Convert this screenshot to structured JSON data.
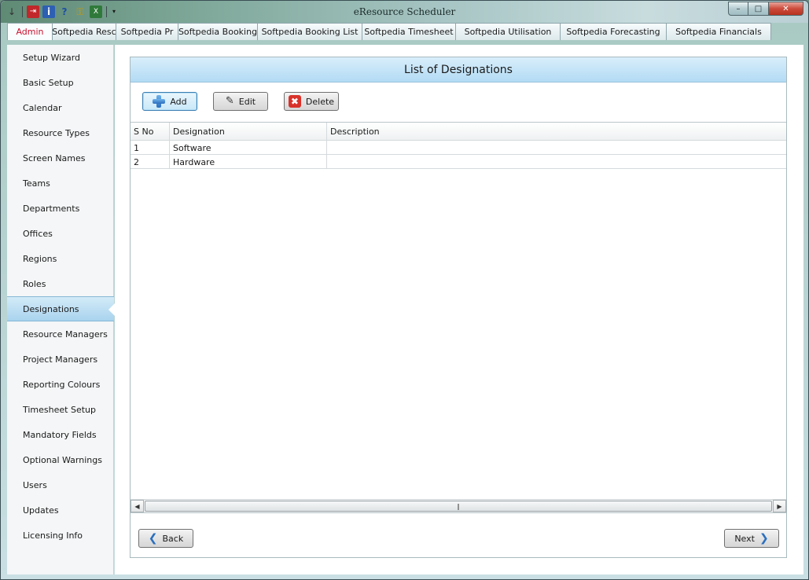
{
  "window": {
    "title": "eResource Scheduler"
  },
  "tabs": [
    {
      "label": "Admin",
      "active": true
    },
    {
      "label": "Softpedia Resc"
    },
    {
      "label": "Softpedia Pr"
    },
    {
      "label": "Softpedia Booking"
    },
    {
      "label": "Softpedia Booking List"
    },
    {
      "label": "Softpedia Timesheet"
    },
    {
      "label": "Softpedia Utilisation"
    },
    {
      "label": "Softpedia Forecasting"
    },
    {
      "label": "Softpedia Financials"
    }
  ],
  "sidebar": {
    "items": [
      {
        "label": "Setup Wizard"
      },
      {
        "label": "Basic Setup"
      },
      {
        "label": "Calendar"
      },
      {
        "label": "Resource Types"
      },
      {
        "label": "Screen Names"
      },
      {
        "label": "Teams"
      },
      {
        "label": "Departments"
      },
      {
        "label": "Offices"
      },
      {
        "label": "Regions"
      },
      {
        "label": "Roles"
      },
      {
        "label": "Designations",
        "active": true
      },
      {
        "label": "Resource Managers"
      },
      {
        "label": "Project Managers"
      },
      {
        "label": "Reporting Colours"
      },
      {
        "label": "Timesheet Setup"
      },
      {
        "label": "Mandatory Fields"
      },
      {
        "label": "Optional Warnings"
      },
      {
        "label": "Users"
      },
      {
        "label": "Updates"
      },
      {
        "label": "Licensing Info"
      }
    ]
  },
  "panel": {
    "title": "List of Designations",
    "toolbar": {
      "add_label": "Add",
      "edit_label": "Edit",
      "delete_label": "Delete"
    },
    "grid": {
      "columns": [
        "S No",
        "Designation",
        "Description"
      ],
      "rows": [
        [
          "1",
          "Software",
          ""
        ],
        [
          "2",
          "Hardware",
          ""
        ]
      ]
    },
    "footer": {
      "back_label": "Back",
      "next_label": "Next"
    }
  },
  "icons": {
    "add": "plus-icon",
    "edit": "pencil-icon",
    "delete": "x-icon",
    "back": "chevron-left-icon",
    "next": "chevron-right-icon"
  },
  "colors": {
    "active_tab_text": "#c8102e",
    "header_blue": "#b2dbf4",
    "sidebar_active": "#a9d3ee"
  }
}
